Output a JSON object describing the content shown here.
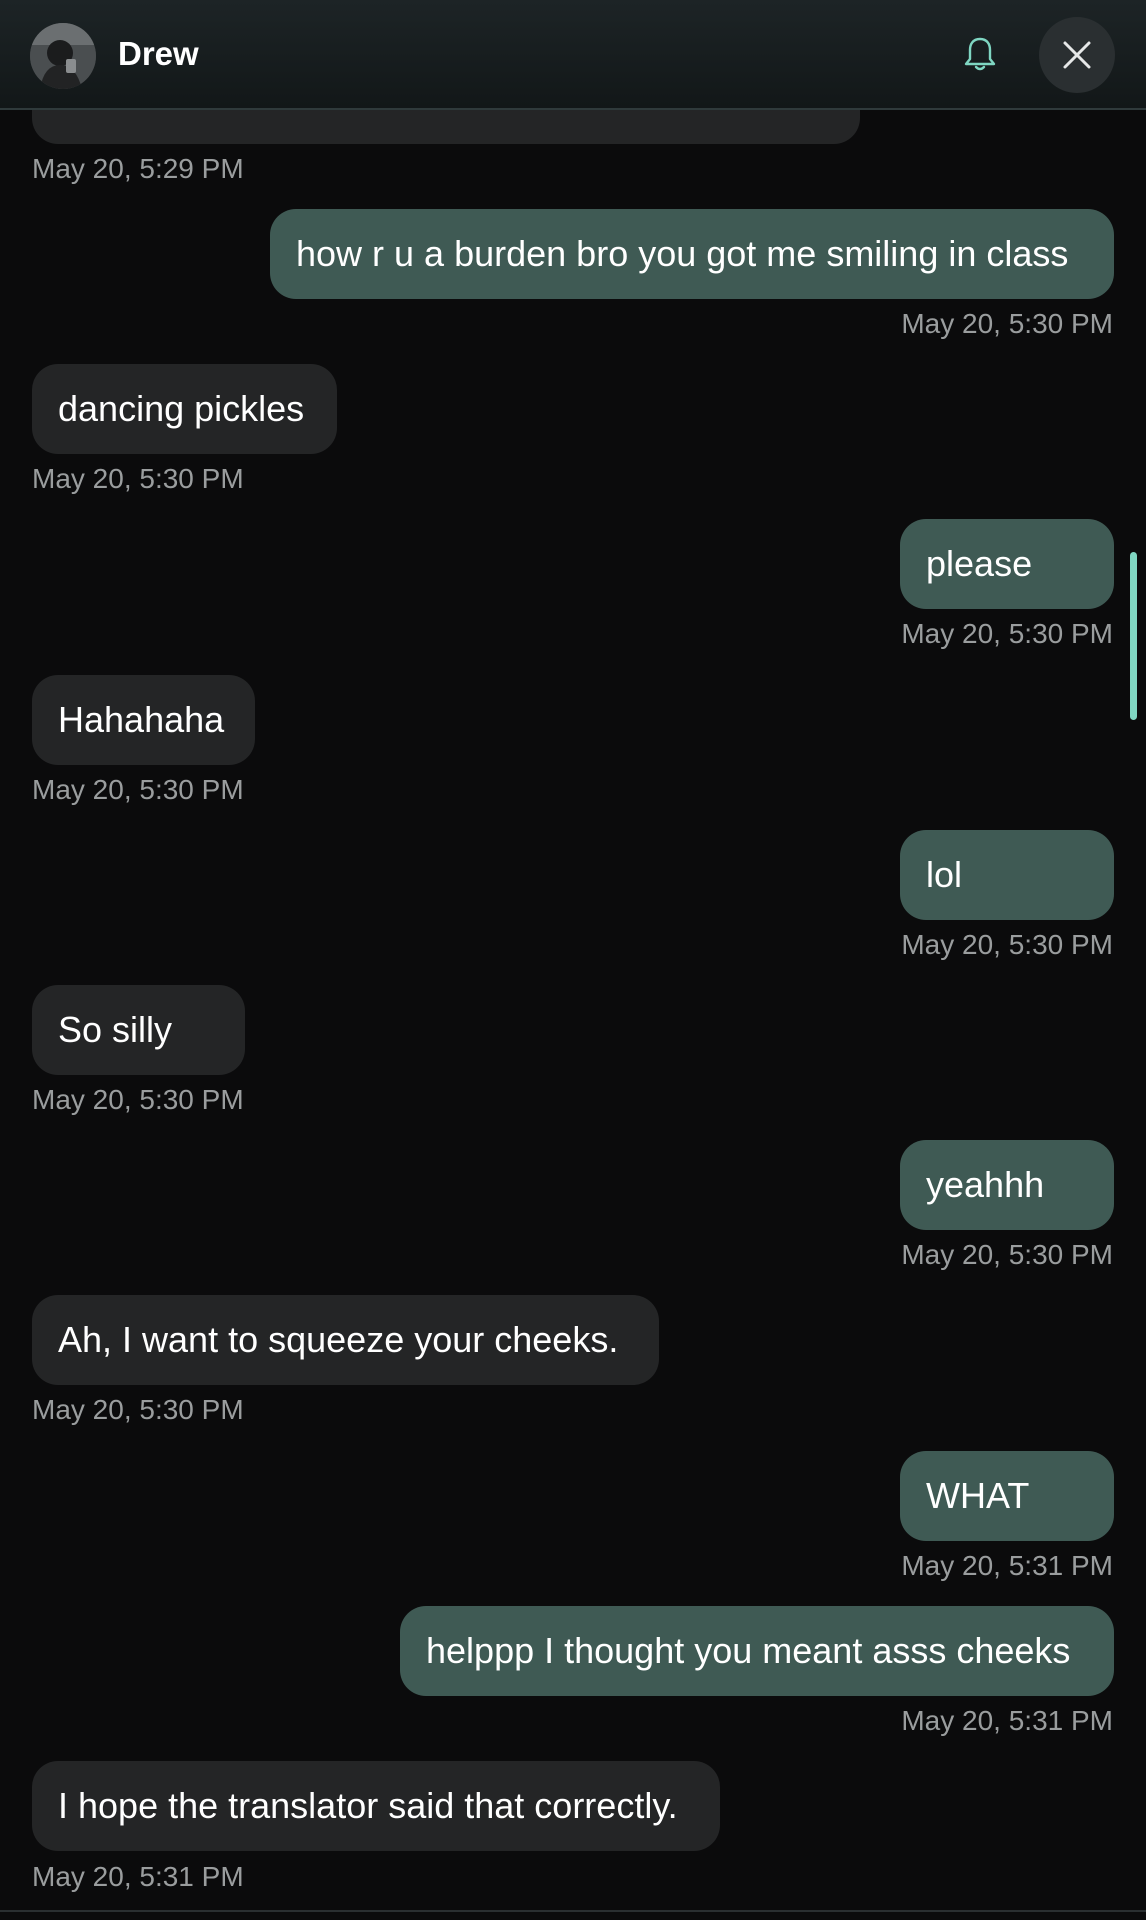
{
  "header": {
    "contact_name": "Drew",
    "bell_icon": "bell-icon",
    "close_icon": "close-icon",
    "accent_color": "#7fd6c2"
  },
  "colors": {
    "background": "#0b0b0c",
    "incoming_bubble": "#242526",
    "outgoing_bubble": "#3f5a54",
    "timestamp": "#9a9d9e"
  },
  "messages": [
    {
      "direction": "in",
      "text": "",
      "time": "May 20, 5:29 PM"
    },
    {
      "direction": "out",
      "text": "how r u a burden bro you got me smiling in class",
      "time": "May 20, 5:30 PM"
    },
    {
      "direction": "in",
      "text": "dancing pickles",
      "time": "May 20, 5:30 PM"
    },
    {
      "direction": "out",
      "text": "please",
      "time": "May 20, 5:30 PM"
    },
    {
      "direction": "in",
      "text": "Hahahaha",
      "time": "May 20, 5:30 PM"
    },
    {
      "direction": "out",
      "text": "lol",
      "time": "May 20, 5:30 PM"
    },
    {
      "direction": "in",
      "text": "So silly",
      "time": "May 20, 5:30 PM"
    },
    {
      "direction": "out",
      "text": "yeahhh",
      "time": "May 20, 5:30 PM"
    },
    {
      "direction": "in",
      "text": "Ah, I want to squeeze your cheeks.",
      "time": "May 20, 5:30 PM"
    },
    {
      "direction": "out",
      "text": "WHAT",
      "time": "May 20, 5:31 PM"
    },
    {
      "direction": "out",
      "text": "helppp I thought you meant asss cheeks",
      "time": "May 20, 5:31 PM"
    },
    {
      "direction": "in",
      "text": "I hope the translator said that correctly.",
      "time": "May 20, 5:31 PM"
    }
  ]
}
